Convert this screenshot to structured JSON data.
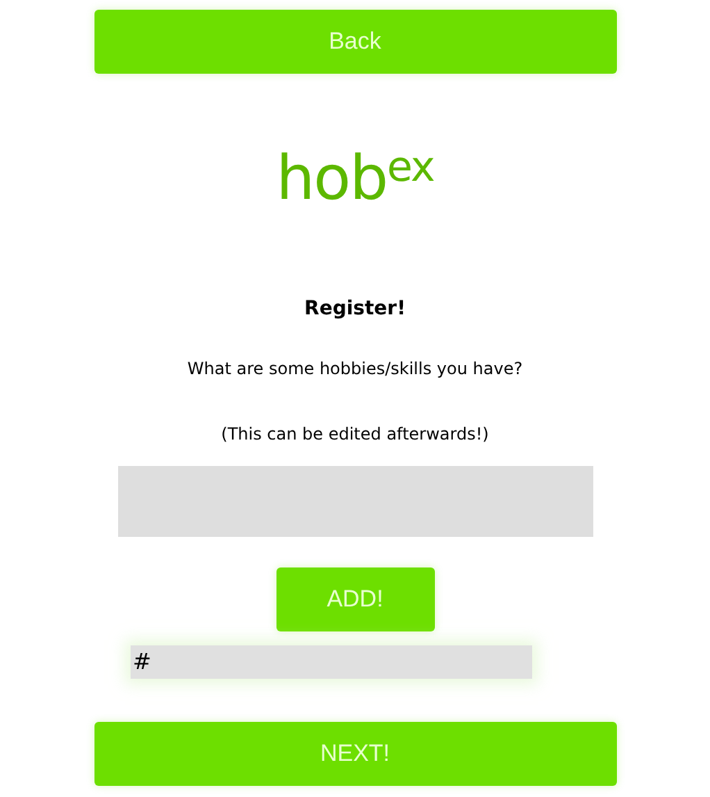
{
  "back_button": {
    "label": "Back"
  },
  "logo": {
    "text": "hob$^{ex}$"
  },
  "heading": "Register!",
  "question": "What are some hobbies/skills you have?",
  "note": "(This can be edited afterwards!)",
  "add_button": {
    "label": "ADD!"
  },
  "tag_field": {
    "value": "#"
  },
  "next_button": {
    "label": "NEXT!"
  }
}
